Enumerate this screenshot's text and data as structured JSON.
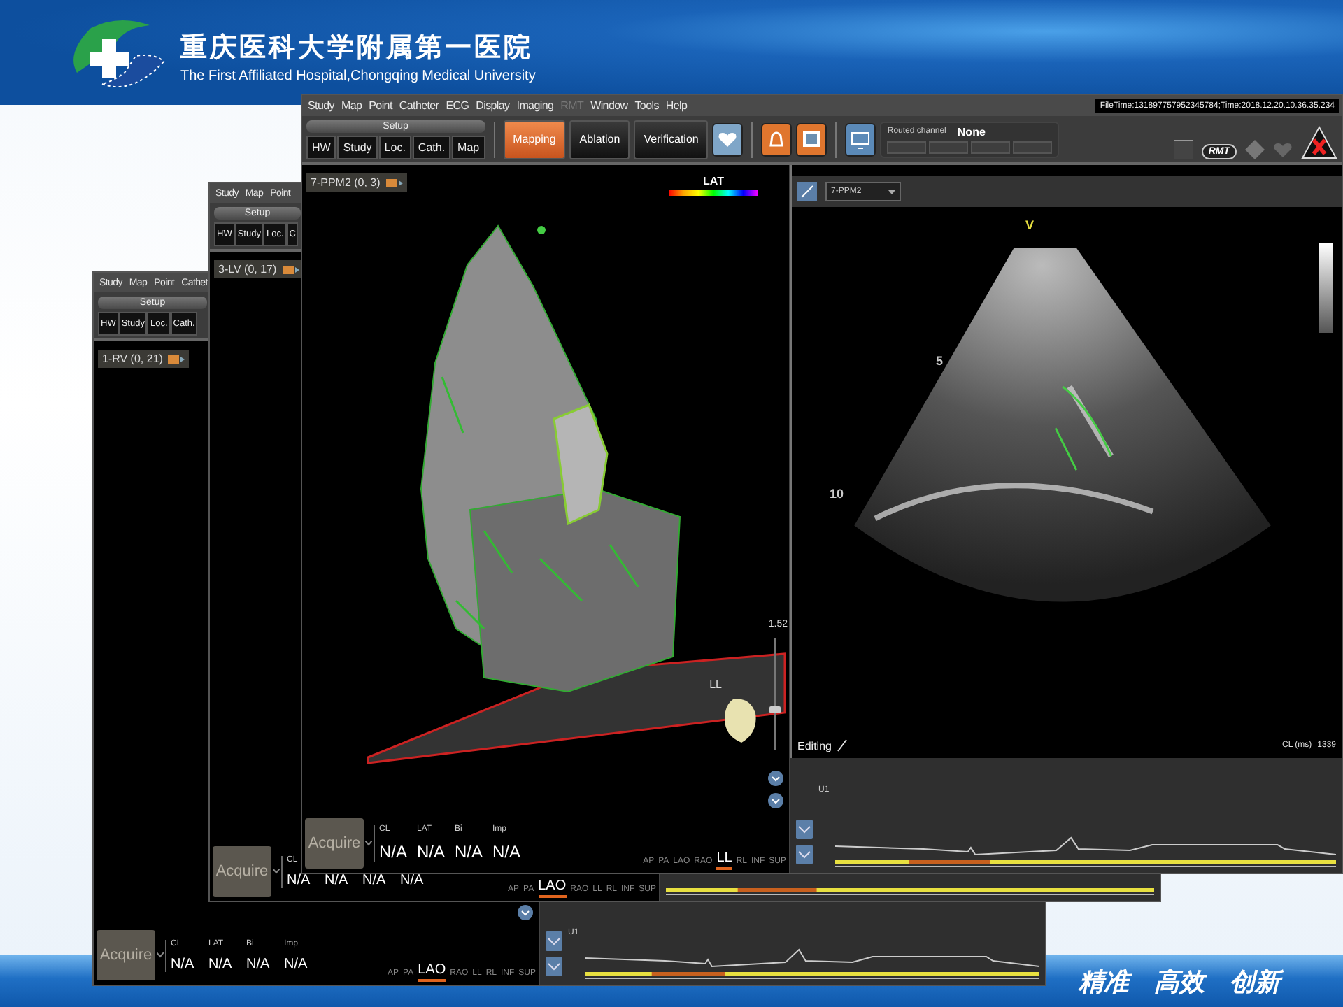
{
  "header": {
    "title_zh": "重庆医科大学附属第一医院",
    "title_en": "The First Affiliated Hospital,Chongqing Medical University"
  },
  "windows": [
    {
      "menu": [
        {
          "label": "Study",
          "disabled": false
        },
        {
          "label": "Map",
          "disabled": false
        },
        {
          "label": "Point",
          "disabled": false
        },
        {
          "label": "Cathet",
          "disabled": false
        }
      ],
      "setup": "Setup",
      "setup_tabs": [
        "HW",
        "Study",
        "Loc.",
        "Cath."
      ],
      "map": {
        "title": "1-RV (0, 21)",
        "acquire": "Acquire",
        "labels": [
          "CL",
          "LAT",
          "Bi",
          "Imp"
        ],
        "values": [
          "N/A",
          "N/A",
          "N/A",
          "N/A"
        ],
        "views": [
          {
            "label": "AP",
            "selected": false
          },
          {
            "label": "PA",
            "selected": false
          },
          {
            "label": "LAO",
            "selected": true
          },
          {
            "label": "RAO",
            "selected": false
          },
          {
            "label": "LL",
            "selected": false
          },
          {
            "label": "RL",
            "selected": false
          },
          {
            "label": "INF",
            "selected": false
          },
          {
            "label": "SUP",
            "selected": false
          }
        ]
      },
      "ecg": {
        "lead": "U1"
      }
    },
    {
      "menu": [
        {
          "label": "Study",
          "disabled": false
        },
        {
          "label": "Map",
          "disabled": false
        },
        {
          "label": "Point",
          "disabled": false
        }
      ],
      "setup": "Setup",
      "setup_tabs": [
        "HW",
        "Study",
        "Loc.",
        "C"
      ],
      "map": {
        "title": "3-LV (0, 17)",
        "acquire": "Acquire",
        "labels": [
          "CL"
        ],
        "values": [
          "N/A",
          "N/A",
          "N/A",
          "N/A"
        ],
        "views": [
          {
            "label": "AP",
            "selected": false
          },
          {
            "label": "PA",
            "selected": false
          },
          {
            "label": "LAO",
            "selected": true
          },
          {
            "label": "RAO",
            "selected": false
          },
          {
            "label": "LL",
            "selected": false
          },
          {
            "label": "RL",
            "selected": false
          },
          {
            "label": "INF",
            "selected": false
          },
          {
            "label": "SUP",
            "selected": false
          }
        ]
      }
    },
    {
      "menu": [
        {
          "label": "Study",
          "disabled": false
        },
        {
          "label": "Map",
          "disabled": false
        },
        {
          "label": "Point",
          "disabled": false
        },
        {
          "label": "Catheter",
          "disabled": false
        },
        {
          "label": "ECG",
          "disabled": false
        },
        {
          "label": "Display",
          "disabled": false
        },
        {
          "label": "Imaging",
          "disabled": false
        },
        {
          "label": "RMT",
          "disabled": true
        },
        {
          "label": "Window",
          "disabled": false
        },
        {
          "label": "Tools",
          "disabled": false
        },
        {
          "label": "Help",
          "disabled": false
        }
      ],
      "file_time": "FileTime:131897757952345784;Time:2018.12.20.10.36.35.234",
      "setup": "Setup",
      "setup_tabs": [
        "HW",
        "Study",
        "Loc.",
        "Cath.",
        "Map"
      ],
      "modes": [
        {
          "label": "Mapping",
          "selected": true
        },
        {
          "label": "Ablation",
          "selected": false
        },
        {
          "label": "Verification",
          "selected": false
        }
      ],
      "routed_channel": {
        "label": "Routed channel",
        "value": "None"
      },
      "status_badge": "RMT",
      "map": {
        "title": "7-PPM2 (0, 3)",
        "legend": "LAT",
        "orientation": "LL",
        "zoom": {
          "value": "1.52",
          "level": 0.35
        },
        "acquire": "Acquire",
        "labels": [
          "CL",
          "LAT",
          "Bi",
          "Imp"
        ],
        "values": [
          "N/A",
          "N/A",
          "N/A",
          "N/A"
        ],
        "views": [
          {
            "label": "AP",
            "selected": false
          },
          {
            "label": "PA",
            "selected": false
          },
          {
            "label": "LAO",
            "selected": false
          },
          {
            "label": "RAO",
            "selected": false
          },
          {
            "label": "LL",
            "selected": true
          },
          {
            "label": "RL",
            "selected": false
          },
          {
            "label": "INF",
            "selected": false
          },
          {
            "label": "SUP",
            "selected": false
          }
        ]
      },
      "echo": {
        "dropdown": "7-PPM2",
        "marker": "V",
        "depths": [
          "5",
          "10"
        ],
        "editing": "Editing",
        "cl_label": "CL (ms)",
        "cl_value": "1339"
      },
      "ecg": {
        "lead": "U1"
      }
    }
  ],
  "footer": {
    "slogan": [
      "精准",
      "高效",
      "创新"
    ]
  }
}
